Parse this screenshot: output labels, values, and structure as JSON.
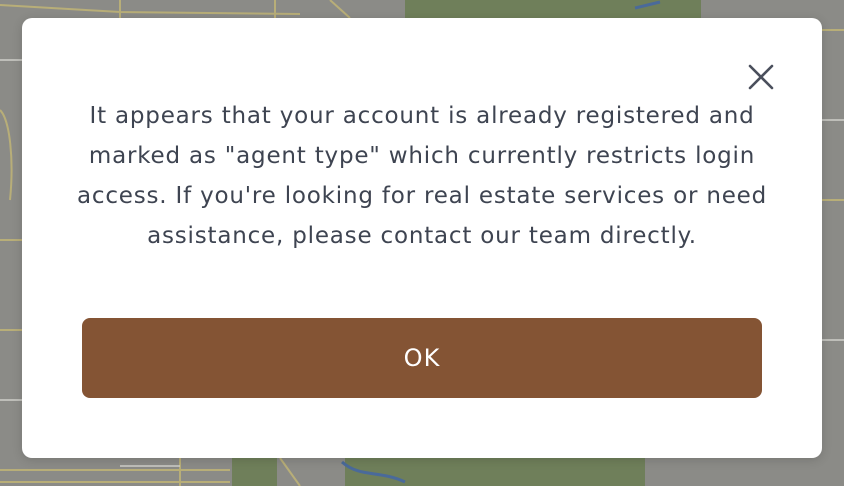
{
  "dialog": {
    "message": "It appears that your account is already registered and marked as \"agent type\" which currently restricts login access. If you're looking for real estate services or need assistance, please contact our team directly.",
    "ok_label": "OK",
    "close_icon": "close-icon"
  },
  "colors": {
    "button_background": "#845434",
    "button_text": "#ffffff",
    "message_text": "#3e4451",
    "overlay_map": "#8a8a86"
  }
}
